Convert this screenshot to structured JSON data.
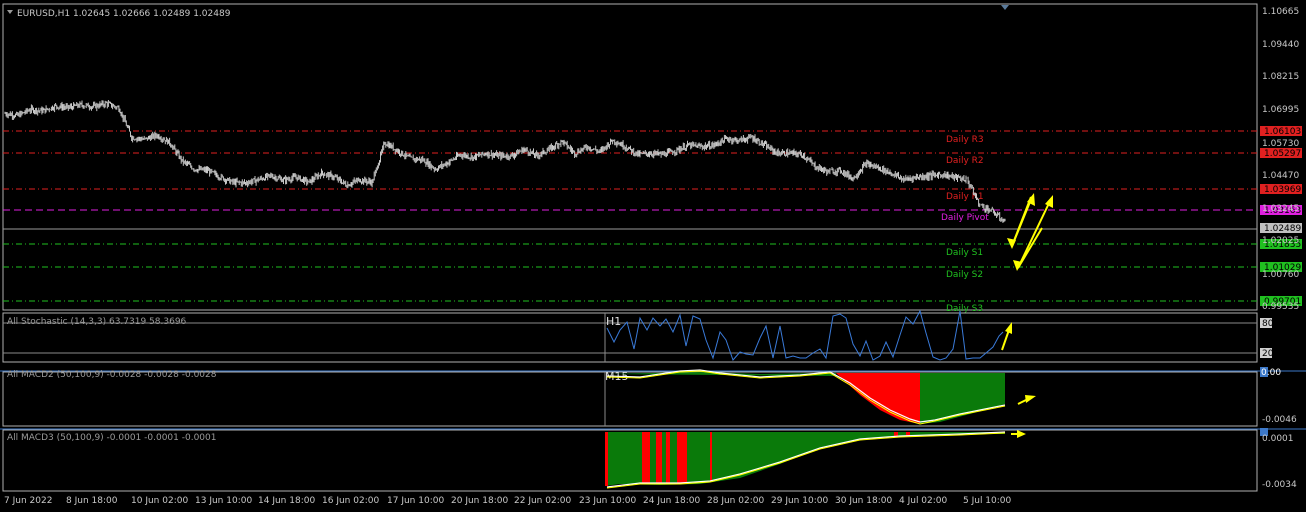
{
  "symbol_header": "EURUSD,H1  1.02645 1.02666 1.02489 1.02489",
  "colors": {
    "background": "#000000",
    "candles": "#c8c8c8",
    "resistance": "#e02020",
    "pivot": "#e020e0",
    "support": "#20c020",
    "current": "#9a9a9a",
    "stoch": "#3a7ad8",
    "macd_green": "#0a7a0a",
    "macd_red": "#ff0000",
    "arrow": "#ffff00",
    "separator": "#3c78c8"
  },
  "price_axis": {
    "ticks": [
      "1.10665",
      "1.09440",
      "1.08215",
      "1.06995",
      "1.05730",
      "1.04470",
      "1.03245",
      "1.02025",
      "1.00760",
      "0.99535"
    ]
  },
  "levels": [
    {
      "name": "Daily R3",
      "value": "1.06103",
      "kind": "resistance"
    },
    {
      "name": "Daily R2",
      "value": "1.05297",
      "kind": "resistance"
    },
    {
      "name": "Daily R1",
      "value": "1.03969",
      "kind": "resistance"
    },
    {
      "name": "Daily Pivot",
      "value": "1.03163",
      "kind": "pivot"
    },
    {
      "name": "current",
      "value": "1.02489",
      "kind": "current"
    },
    {
      "name": "Daily S1",
      "value": "1.01835",
      "kind": "support"
    },
    {
      "name": "Daily S2",
      "value": "1.01029",
      "kind": "support"
    },
    {
      "name": "Daily S3",
      "value": "0.99701",
      "kind": "support"
    }
  ],
  "stochastic": {
    "title": "All Stochastic (14,3,3) 63.7319 58.3696",
    "timeframe": "H1",
    "tick_high": "80",
    "tick_low": "20"
  },
  "macd2": {
    "title": "All MACD2 (50,100,9) -0.0028 -0.0028 -0.0028",
    "timeframe": "M15",
    "tick_top": "0.00",
    "tick_bottom": "-0.0046"
  },
  "macd3": {
    "title": "All MACD3 (50,100,9) -0.0001 -0.0001 -0.0001",
    "timeframe": "M5",
    "tick_top": "0.0001",
    "tick_bottom": "-0.0034"
  },
  "time_axis": [
    "7 Jun 2022",
    "8 Jun 18:00",
    "10 Jun 02:00",
    "13 Jun 10:00",
    "14 Jun 18:00",
    "16 Jun 02:00",
    "17 Jun 10:00",
    "20 Jun 18:00",
    "22 Jun 02:00",
    "23 Jun 10:00",
    "24 Jun 18:00",
    "28 Jun 02:00",
    "29 Jun 10:00",
    "30 Jun 18:00",
    "4 Jul 02:00",
    "5 Jul 10:00"
  ],
  "chart_data": {
    "type": "candlestick",
    "symbol": "EURUSD",
    "timeframe": "H1",
    "last": {
      "open": 1.02645,
      "high": 1.02666,
      "low": 1.02489,
      "close": 1.02489
    },
    "close_path": [
      1.068,
      1.0672,
      1.0695,
      1.069,
      1.0708,
      1.0702,
      1.0712,
      1.0706,
      1.0718,
      1.07,
      1.059,
      1.0582,
      1.0598,
      1.057,
      1.05,
      1.047,
      1.0465,
      1.044,
      1.042,
      1.0418,
      1.043,
      1.0445,
      1.0428,
      1.044,
      1.042,
      1.0455,
      1.044,
      1.041,
      1.043,
      1.042,
      1.057,
      1.054,
      1.051,
      1.0505,
      1.047,
      1.0495,
      1.0525,
      1.0515,
      1.053,
      1.052,
      1.052,
      1.0545,
      1.052,
      1.0545,
      1.0575,
      1.053,
      1.0555,
      1.0535,
      1.058,
      1.0555,
      1.0525,
      1.053,
      1.0525,
      1.054,
      1.056,
      1.0555,
      1.056,
      1.0585,
      1.0578,
      1.059,
      1.056,
      1.053,
      1.053,
      1.0525,
      1.048,
      1.046,
      1.0465,
      1.0435,
      1.049,
      1.0475,
      1.0455,
      1.043,
      1.044,
      1.0445,
      1.045,
      1.044,
      1.043,
      1.0335,
      1.031,
      1.027
    ]
  }
}
